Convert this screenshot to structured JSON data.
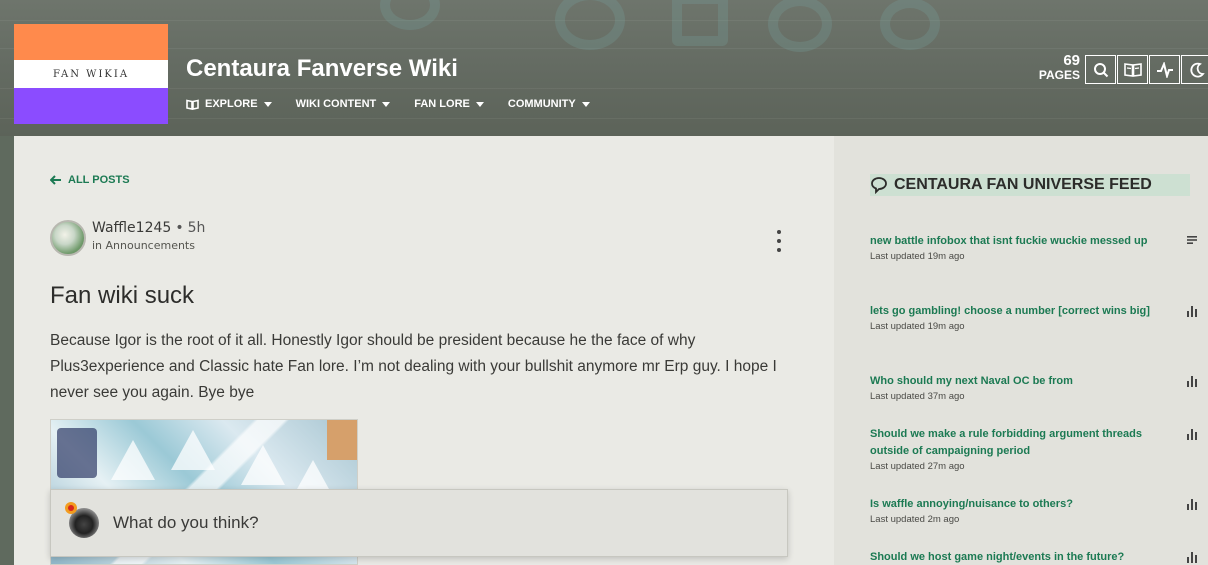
{
  "header": {
    "logo_text": "FAN WIKIA",
    "wiki_title": "Centaura Fanverse Wiki",
    "nav": [
      {
        "label": "EXPLORE",
        "icon": "book-icon"
      },
      {
        "label": "WIKI CONTENT"
      },
      {
        "label": "FAN LORE"
      },
      {
        "label": "COMMUNITY"
      }
    ],
    "pages_count": "69",
    "pages_label": "PAGES",
    "tools": [
      "search-icon",
      "reading-icon",
      "activity-icon",
      "moon-icon"
    ]
  },
  "post": {
    "back_label": "ALL POSTS",
    "author": "Waffle1245",
    "dot": "•",
    "time": "5h",
    "category": "in Announcements",
    "title": "Fan wiki suck",
    "body": "Because Igor is the root of it all. Honestly Igor should be president because he the face of why Plus3experience and Classic hate Fan lore. I’m not dealing with your bullshit anymore mr Erp guy. I hope I never see you again. Bye bye",
    "reply_placeholder": "What do you think?"
  },
  "feed": {
    "title": "CENTAURA FAN UNIVERSE FEED",
    "items": [
      {
        "title": "new battle infobox that isnt fuckie wuckie messed up",
        "updated": "Last updated 19m ago",
        "icon": "text-lines-icon"
      },
      {
        "title": "lets go gambling! choose a number [correct wins big]",
        "updated": "Last updated 19m ago",
        "icon": "poll-icon"
      },
      {
        "title": "Who should my next Naval OC be from",
        "updated": "Last updated 37m ago",
        "icon": "poll-icon"
      },
      {
        "title": "Should we make a rule forbidding argument threads outside of campaigning period",
        "updated": "Last updated 27m ago",
        "icon": "poll-icon"
      },
      {
        "title": "Is waffle annoying/nuisance to others?",
        "updated": "Last updated 2m ago",
        "icon": "poll-icon"
      },
      {
        "title": "Should we host game night/events in the future?",
        "updated": "",
        "icon": "poll-icon"
      }
    ]
  },
  "colors": {
    "accent": "#1c7a53",
    "logo_orange": "#ff8a4c",
    "logo_purple": "#8b4cff",
    "feed_title_bg": "#cde0d2"
  }
}
